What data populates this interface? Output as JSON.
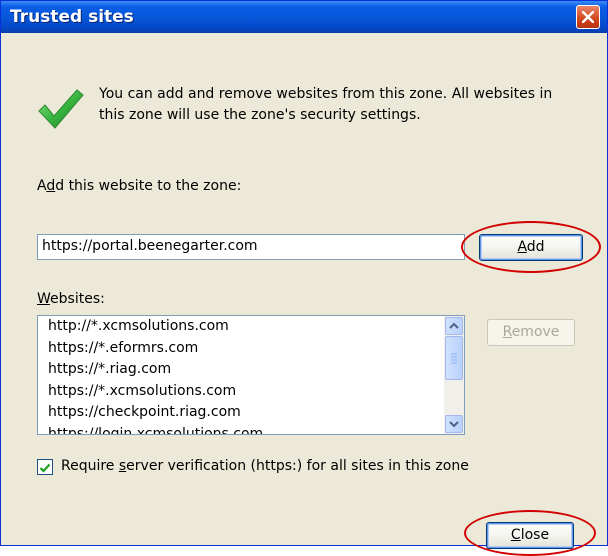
{
  "window": {
    "title": "Trusted sites"
  },
  "info": {
    "line1": "You can add and remove websites from this zone. All websites in",
    "line2": "this zone will use the zone's security settings."
  },
  "add_section": {
    "label_pre": "A",
    "label_mnemonic": "d",
    "label_post": "d this website to the zone:",
    "input_value": "https://portal.beenegarter.com",
    "add_button_mnemonic": "A",
    "add_button_rest": "dd"
  },
  "websites": {
    "label_mnemonic": "W",
    "label_rest": "ebsites:",
    "items": [
      "http://*.xcmsolutions.com",
      "https://*.eformrs.com",
      "https://*.riag.com",
      "https://*.xcmsolutions.com",
      "https://checkpoint.riag.com",
      "https://login.xcmsolutions.com"
    ],
    "remove_button_mnemonic": "R",
    "remove_button_rest": "emove"
  },
  "verification": {
    "checked": true,
    "label_pre": "Require ",
    "label_mnemonic": "s",
    "label_post": "erver verification (https:) for all sites in this zone"
  },
  "footer": {
    "close_button_mnemonic": "C",
    "close_button_rest": "lose"
  },
  "colors": {
    "titlebar": "#0756d8",
    "dialog_bg": "#ece9d8",
    "highlight_ellipse": "#d20000",
    "checkmark": "#3ab540"
  }
}
